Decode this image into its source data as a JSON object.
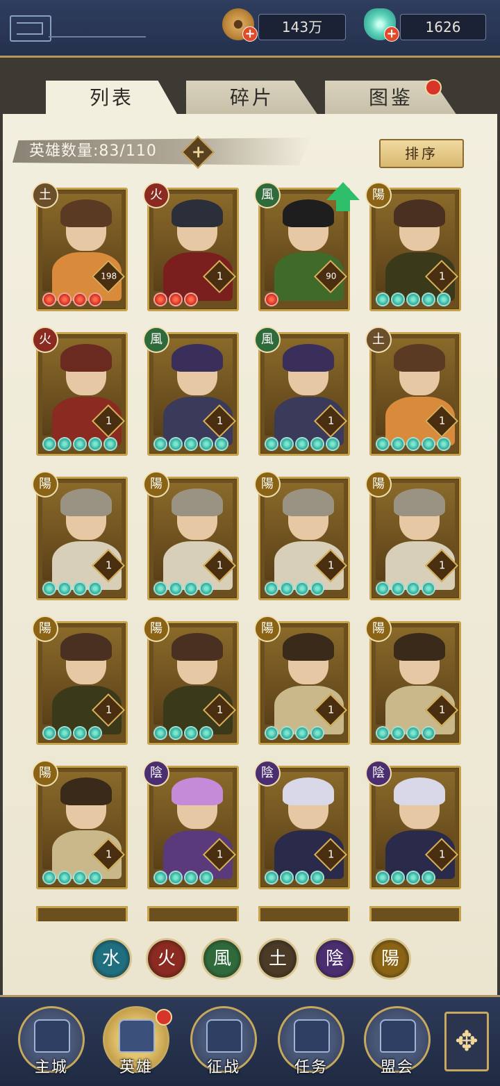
{
  "resources": {
    "coins": "143万",
    "jade": "1626"
  },
  "tabs": [
    {
      "label": "列表",
      "active": true
    },
    {
      "label": "碎片",
      "active": false
    },
    {
      "label": "图鉴",
      "active": false,
      "badge": true
    }
  ],
  "hero_count": {
    "label": "英雄数量:",
    "value": "83/110"
  },
  "sort_label": "排序",
  "heroes": [
    {
      "element": "土",
      "level": "198",
      "stars": 4,
      "star_color": "red"
    },
    {
      "element": "火",
      "level": "1",
      "stars": 3,
      "star_color": "red"
    },
    {
      "element": "風",
      "level": "90",
      "stars": 1,
      "star_color": "red",
      "upgrade": true
    },
    {
      "element": "陽",
      "level": "1",
      "stars": 5,
      "star_color": "green"
    },
    {
      "element": "火",
      "level": "1",
      "stars": 5,
      "star_color": "green"
    },
    {
      "element": "風",
      "level": "1",
      "stars": 5,
      "star_color": "green"
    },
    {
      "element": "風",
      "level": "1",
      "stars": 5,
      "star_color": "green"
    },
    {
      "element": "土",
      "level": "1",
      "stars": 5,
      "star_color": "green"
    },
    {
      "element": "陽",
      "level": "1",
      "stars": 4,
      "star_color": "green"
    },
    {
      "element": "陽",
      "level": "1",
      "stars": 4,
      "star_color": "green"
    },
    {
      "element": "陽",
      "level": "1",
      "stars": 4,
      "star_color": "green"
    },
    {
      "element": "陽",
      "level": "1",
      "stars": 4,
      "star_color": "green"
    },
    {
      "element": "陽",
      "level": "1",
      "stars": 4,
      "star_color": "green"
    },
    {
      "element": "陽",
      "level": "1",
      "stars": 4,
      "star_color": "green"
    },
    {
      "element": "陽",
      "level": "1",
      "stars": 4,
      "star_color": "green"
    },
    {
      "element": "陽",
      "level": "1",
      "stars": 4,
      "star_color": "green"
    },
    {
      "element": "陽",
      "level": "1",
      "stars": 4,
      "star_color": "green"
    },
    {
      "element": "陰",
      "level": "1",
      "stars": 4,
      "star_color": "green"
    },
    {
      "element": "陰",
      "level": "1",
      "stars": 4,
      "star_color": "green"
    },
    {
      "element": "陰",
      "level": "1",
      "stars": 4,
      "star_color": "green"
    }
  ],
  "element_filters": [
    {
      "glyph": "水",
      "color": "#1f6f80"
    },
    {
      "glyph": "火",
      "color": "#8a2a20"
    },
    {
      "glyph": "風",
      "color": "#2f6a3a"
    },
    {
      "glyph": "土",
      "color": "#4a3a26"
    },
    {
      "glyph": "陰",
      "color": "#4a2e70"
    },
    {
      "glyph": "陽",
      "color": "#8a6414"
    }
  ],
  "element_colors": {
    "土": "#6b4f2a",
    "火": "#8a2a20",
    "風": "#2f6a3a",
    "陽": "#8a6414",
    "陰": "#4a2e70",
    "水": "#1f6f80"
  },
  "nav": [
    {
      "label": "主城",
      "icon": "city-gate-icon",
      "active": false
    },
    {
      "label": "英雄",
      "icon": "hero-portrait-icon",
      "active": true,
      "badge": true
    },
    {
      "label": "征战",
      "icon": "battle-icon",
      "active": false
    },
    {
      "label": "任务",
      "icon": "quest-scroll-icon",
      "active": false
    },
    {
      "label": "盟会",
      "icon": "guild-pavilion-icon",
      "active": false
    }
  ]
}
